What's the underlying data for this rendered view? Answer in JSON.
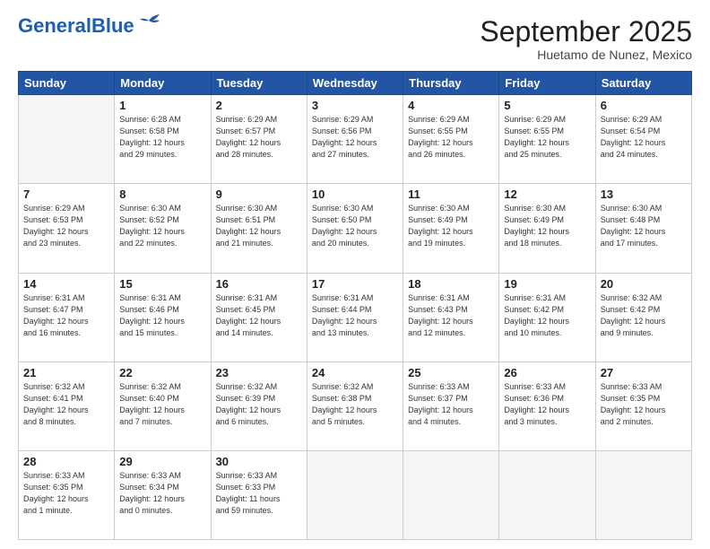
{
  "header": {
    "logo_general": "General",
    "logo_blue": "Blue",
    "month": "September 2025",
    "location": "Huetamo de Nunez, Mexico"
  },
  "weekdays": [
    "Sunday",
    "Monday",
    "Tuesday",
    "Wednesday",
    "Thursday",
    "Friday",
    "Saturday"
  ],
  "weeks": [
    [
      {
        "day": "",
        "info": ""
      },
      {
        "day": "1",
        "info": "Sunrise: 6:28 AM\nSunset: 6:58 PM\nDaylight: 12 hours\nand 29 minutes."
      },
      {
        "day": "2",
        "info": "Sunrise: 6:29 AM\nSunset: 6:57 PM\nDaylight: 12 hours\nand 28 minutes."
      },
      {
        "day": "3",
        "info": "Sunrise: 6:29 AM\nSunset: 6:56 PM\nDaylight: 12 hours\nand 27 minutes."
      },
      {
        "day": "4",
        "info": "Sunrise: 6:29 AM\nSunset: 6:55 PM\nDaylight: 12 hours\nand 26 minutes."
      },
      {
        "day": "5",
        "info": "Sunrise: 6:29 AM\nSunset: 6:55 PM\nDaylight: 12 hours\nand 25 minutes."
      },
      {
        "day": "6",
        "info": "Sunrise: 6:29 AM\nSunset: 6:54 PM\nDaylight: 12 hours\nand 24 minutes."
      }
    ],
    [
      {
        "day": "7",
        "info": "Sunrise: 6:29 AM\nSunset: 6:53 PM\nDaylight: 12 hours\nand 23 minutes."
      },
      {
        "day": "8",
        "info": "Sunrise: 6:30 AM\nSunset: 6:52 PM\nDaylight: 12 hours\nand 22 minutes."
      },
      {
        "day": "9",
        "info": "Sunrise: 6:30 AM\nSunset: 6:51 PM\nDaylight: 12 hours\nand 21 minutes."
      },
      {
        "day": "10",
        "info": "Sunrise: 6:30 AM\nSunset: 6:50 PM\nDaylight: 12 hours\nand 20 minutes."
      },
      {
        "day": "11",
        "info": "Sunrise: 6:30 AM\nSunset: 6:49 PM\nDaylight: 12 hours\nand 19 minutes."
      },
      {
        "day": "12",
        "info": "Sunrise: 6:30 AM\nSunset: 6:49 PM\nDaylight: 12 hours\nand 18 minutes."
      },
      {
        "day": "13",
        "info": "Sunrise: 6:30 AM\nSunset: 6:48 PM\nDaylight: 12 hours\nand 17 minutes."
      }
    ],
    [
      {
        "day": "14",
        "info": "Sunrise: 6:31 AM\nSunset: 6:47 PM\nDaylight: 12 hours\nand 16 minutes."
      },
      {
        "day": "15",
        "info": "Sunrise: 6:31 AM\nSunset: 6:46 PM\nDaylight: 12 hours\nand 15 minutes."
      },
      {
        "day": "16",
        "info": "Sunrise: 6:31 AM\nSunset: 6:45 PM\nDaylight: 12 hours\nand 14 minutes."
      },
      {
        "day": "17",
        "info": "Sunrise: 6:31 AM\nSunset: 6:44 PM\nDaylight: 12 hours\nand 13 minutes."
      },
      {
        "day": "18",
        "info": "Sunrise: 6:31 AM\nSunset: 6:43 PM\nDaylight: 12 hours\nand 12 minutes."
      },
      {
        "day": "19",
        "info": "Sunrise: 6:31 AM\nSunset: 6:42 PM\nDaylight: 12 hours\nand 10 minutes."
      },
      {
        "day": "20",
        "info": "Sunrise: 6:32 AM\nSunset: 6:42 PM\nDaylight: 12 hours\nand 9 minutes."
      }
    ],
    [
      {
        "day": "21",
        "info": "Sunrise: 6:32 AM\nSunset: 6:41 PM\nDaylight: 12 hours\nand 8 minutes."
      },
      {
        "day": "22",
        "info": "Sunrise: 6:32 AM\nSunset: 6:40 PM\nDaylight: 12 hours\nand 7 minutes."
      },
      {
        "day": "23",
        "info": "Sunrise: 6:32 AM\nSunset: 6:39 PM\nDaylight: 12 hours\nand 6 minutes."
      },
      {
        "day": "24",
        "info": "Sunrise: 6:32 AM\nSunset: 6:38 PM\nDaylight: 12 hours\nand 5 minutes."
      },
      {
        "day": "25",
        "info": "Sunrise: 6:33 AM\nSunset: 6:37 PM\nDaylight: 12 hours\nand 4 minutes."
      },
      {
        "day": "26",
        "info": "Sunrise: 6:33 AM\nSunset: 6:36 PM\nDaylight: 12 hours\nand 3 minutes."
      },
      {
        "day": "27",
        "info": "Sunrise: 6:33 AM\nSunset: 6:35 PM\nDaylight: 12 hours\nand 2 minutes."
      }
    ],
    [
      {
        "day": "28",
        "info": "Sunrise: 6:33 AM\nSunset: 6:35 PM\nDaylight: 12 hours\nand 1 minute."
      },
      {
        "day": "29",
        "info": "Sunrise: 6:33 AM\nSunset: 6:34 PM\nDaylight: 12 hours\nand 0 minutes."
      },
      {
        "day": "30",
        "info": "Sunrise: 6:33 AM\nSunset: 6:33 PM\nDaylight: 11 hours\nand 59 minutes."
      },
      {
        "day": "",
        "info": ""
      },
      {
        "day": "",
        "info": ""
      },
      {
        "day": "",
        "info": ""
      },
      {
        "day": "",
        "info": ""
      }
    ]
  ]
}
